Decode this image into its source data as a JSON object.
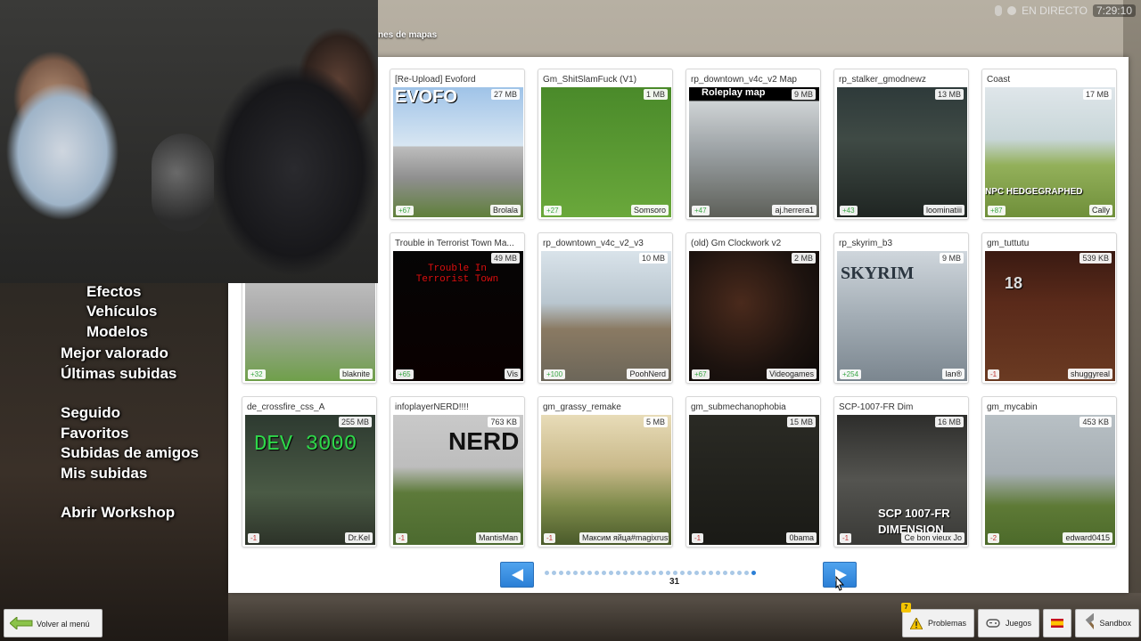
{
  "stream": {
    "status_label": "EN DIRECTO",
    "timer": "7:29:10"
  },
  "category_title": "nes de mapas",
  "menu": {
    "efectos": "Efectos",
    "vehiculos": "Vehículos",
    "modelos": "Modelos",
    "mejor_valorado": "Mejor valorado",
    "ultimas_subidas": "Últimas subidas",
    "seguido": "Seguido",
    "favoritos": "Favoritos",
    "subidas_amigos": "Subidas de amigos",
    "mis_subidas": "Mis subidas",
    "abrir_workshop": "Abrir Workshop"
  },
  "items": [
    {
      "title": "[Re-Upload] Evoford",
      "size": "27 MB",
      "votes": "+67",
      "author": "Brolala",
      "neg": false,
      "thumb": "evoford",
      "label": "EVOFO"
    },
    {
      "title": "Gm_ShitSlamFuck (V1)",
      "size": "1 MB",
      "votes": "+27",
      "author": "Somsoro",
      "neg": false,
      "thumb": "slam",
      "label": ""
    },
    {
      "title": "rp_downtown_v4c_v2 Map",
      "size": "9 MB",
      "votes": "+47",
      "author": "aj.herrera1",
      "neg": false,
      "thumb": "downtown",
      "label": "Roleplay map"
    },
    {
      "title": "rp_stalker_gmodnewz",
      "size": "13 MB",
      "votes": "+43",
      "author": "loominatiii",
      "neg": false,
      "thumb": "stalker",
      "label": ""
    },
    {
      "title": "Coast",
      "size": "17 MB",
      "votes": "+87",
      "author": "Cally",
      "neg": false,
      "thumb": "coast",
      "label": "NPC HEDGEGRAPHED"
    },
    {
      "title": "",
      "size": "",
      "votes": "+32",
      "author": "blaknite",
      "neg": false,
      "thumb": "flat",
      "label": ""
    },
    {
      "title": "Trouble in Terrorist Town Ma...",
      "size": "49 MB",
      "votes": "+65",
      "author": "Vis",
      "neg": false,
      "thumb": "ttt",
      "label": "Trouble In Terrorist Town"
    },
    {
      "title": "rp_downtown_v4c_v2_v3",
      "size": "10 MB",
      "votes": "+100",
      "author": "PoohNerd",
      "neg": false,
      "thumb": "downtown2",
      "label": ""
    },
    {
      "title": "(old) Gm Clockwork v2",
      "size": "2 MB",
      "votes": "+67",
      "author": "Videogames",
      "neg": false,
      "thumb": "clockwork",
      "label": ""
    },
    {
      "title": "rp_skyrim_b3",
      "size": "9 MB",
      "votes": "+254",
      "author": "lan®",
      "neg": false,
      "thumb": "skyrim",
      "label": "SKYRIM"
    },
    {
      "title": "gm_tuttutu",
      "size": "539 KB",
      "votes": "-1",
      "author": "shuggyreal",
      "neg": true,
      "thumb": "tuttutu",
      "label": "18"
    },
    {
      "title": "de_crossfire_css_A",
      "size": "255 MB",
      "votes": "-1",
      "author": "Dr.Kel",
      "neg": true,
      "thumb": "crossfire",
      "label": "DEV 3000"
    },
    {
      "title": "infoplayerNERD!!!!",
      "size": "763 KB",
      "votes": "-1",
      "author": "MantisMan",
      "neg": true,
      "thumb": "nerd",
      "label": "NERD"
    },
    {
      "title": "gm_grassy_remake",
      "size": "5 MB",
      "votes": "-1",
      "author": "Максим яйца#magixrust",
      "neg": true,
      "thumb": "grassy",
      "label": ""
    },
    {
      "title": "gm_submechanophobia",
      "size": "15 MB",
      "votes": "-1",
      "author": "0bama",
      "neg": true,
      "thumb": "sub",
      "label": ""
    },
    {
      "title": "SCP-1007-FR Dim",
      "size": "16 MB",
      "votes": "-1",
      "author": "Ce bon vieux Jo",
      "neg": true,
      "thumb": "scp",
      "label": "SCP 1007-FR DIMENSION"
    },
    {
      "title": "gm_mycabin",
      "size": "453 KB",
      "votes": "-2",
      "author": "edward0415",
      "neg": true,
      "thumb": "cabin",
      "label": ""
    }
  ],
  "pagination": {
    "current_page": "31",
    "dot_count": 30,
    "active_dot": 29
  },
  "bottom": {
    "back_label": "Volver al menú",
    "problems_label": "Problemas",
    "problems_count": "7",
    "games_label": "Juegos",
    "sandbox_label": "Sandbox"
  }
}
